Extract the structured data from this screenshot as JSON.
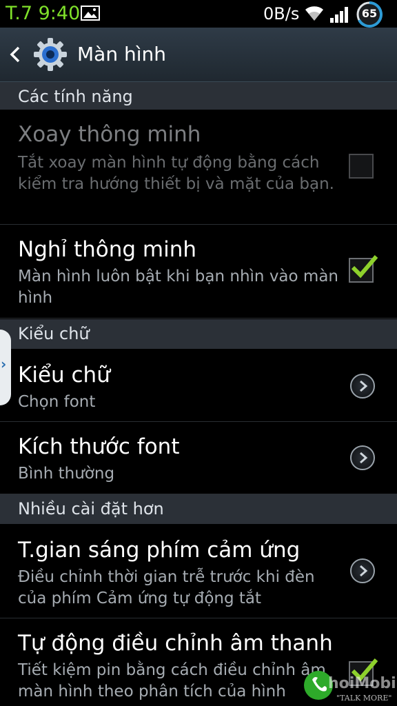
{
  "status_bar": {
    "time": "T.7 9:40",
    "network_speed": "0B/s",
    "battery_level": "65",
    "icons": [
      "gallery-icon",
      "wifi-icon",
      "signal-icon",
      "battery-icon"
    ]
  },
  "title_bar": {
    "title": "Màn hình",
    "icons": [
      "back-icon",
      "gear-icon"
    ]
  },
  "sections": [
    {
      "header": "Các tính năng"
    },
    {
      "header": "Kiểu chữ"
    },
    {
      "header": "Nhiều cài đặt hơn"
    }
  ],
  "items": [
    {
      "title": "Xoay thông minh",
      "subtitle": "Tắt xoay màn hình tự động bằng cách kiểm tra hướng thiết bị và mặt của bạn.",
      "control": "checkbox",
      "checked": false,
      "enabled": false
    },
    {
      "title": "Nghỉ thông minh",
      "subtitle": "Màn hình luôn bật khi bạn nhìn vào màn hình",
      "control": "checkbox",
      "checked": true,
      "enabled": true
    },
    {
      "title": "Kiểu chữ",
      "subtitle": "Chọn font",
      "control": "chevron"
    },
    {
      "title": "Kích thước font",
      "subtitle": "Bình thường",
      "control": "chevron"
    },
    {
      "title": "T.gian sáng phím cảm ứng",
      "subtitle": "Điều chỉnh thời gian trễ trước khi đèn của phím Cảm ứng tự động tắt",
      "control": "chevron"
    },
    {
      "title": "Tự động điều chỉnh âm thanh",
      "subtitle": "Tiết kiệm pin bằng cách điều chỉnh âm màn hình theo phân tích của hình",
      "control": "checkbox",
      "checked": true,
      "enabled": true
    }
  ],
  "side_tab": {
    "glyph": "›"
  },
  "watermark": {
    "brand": "ChoiMobile",
    "tagline": "\"TALK MORE\""
  },
  "colors": {
    "accent_check": "#8ed12c",
    "status_time": "#7fe02a",
    "section_bg": "#2b3037",
    "subtitle_text": "#a6acb2"
  }
}
